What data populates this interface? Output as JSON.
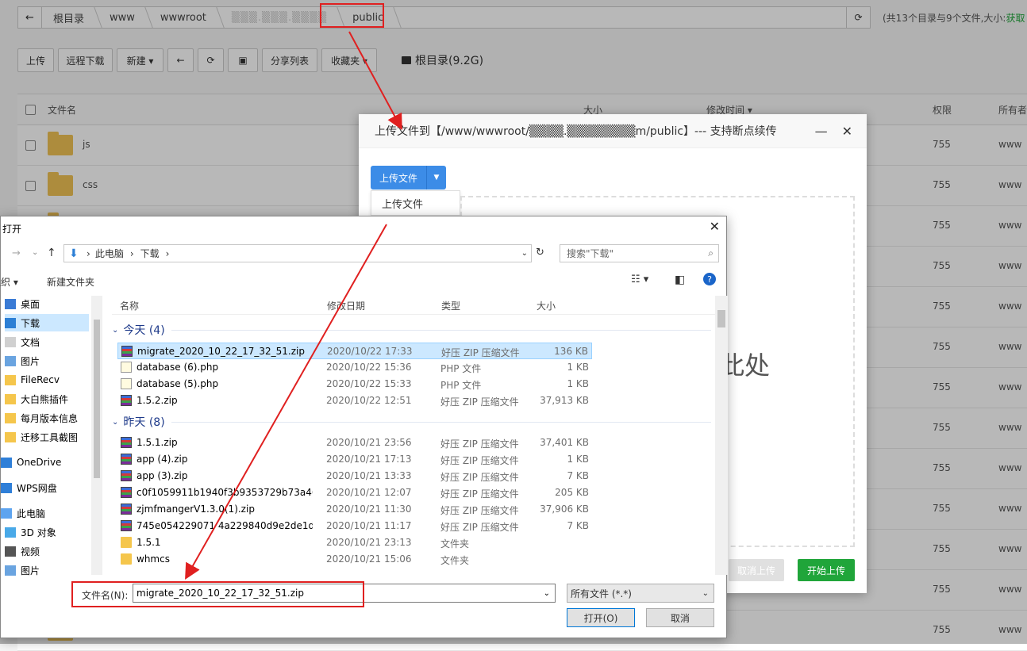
{
  "filemanager": {
    "crumbs": [
      "根目录",
      "www",
      "wwwroot",
      "▒▒▒.▒▒▒.▒▒▒▒",
      "public"
    ],
    "summary": "(共13个目录与9个文件,大小:",
    "summary_link": "获取",
    "toolbar": [
      "上传",
      "远程下载",
      "新建 ▾",
      "←",
      "⟳",
      "▣",
      "分享列表",
      "收藏夹 ▾"
    ],
    "disk": "根目录(9.2G)",
    "headers": {
      "name": "文件名",
      "size": "大小",
      "mtime": "修改时间 ▾",
      "perm": "权限",
      "owner": "所有者"
    },
    "rows": [
      {
        "name": "js",
        "perm": "755",
        "owner": "www"
      },
      {
        "name": "css",
        "perm": "755",
        "owner": "www"
      },
      {
        "name": "",
        "perm": "755",
        "owner": "www"
      },
      {
        "name": "",
        "perm": "755",
        "owner": "www"
      },
      {
        "name": "",
        "perm": "755",
        "owner": "www"
      },
      {
        "name": "",
        "perm": "755",
        "owner": "www"
      },
      {
        "name": "",
        "perm": "755",
        "owner": "www"
      },
      {
        "name": "",
        "perm": "755",
        "owner": "www"
      },
      {
        "name": "",
        "perm": "755",
        "owner": "www"
      },
      {
        "name": "",
        "perm": "755",
        "owner": "www"
      },
      {
        "name": "",
        "perm": "755",
        "owner": "www"
      },
      {
        "name": "",
        "perm": "755",
        "owner": "www"
      },
      {
        "name": "",
        "perm": "755",
        "owner": "www"
      }
    ]
  },
  "upload": {
    "title": "上传文件到【/www/wwwroot/▒▒▒▒.▒▒▒▒▒▒▒▒m/public】--- 支持断点续传",
    "button": "上传文件",
    "dropdown_item": "上传文件",
    "drop_text": "到此处",
    "cancel": "取消上传",
    "start": "开始上传"
  },
  "dialog": {
    "title": "打开",
    "path": [
      "此电脑",
      "下载"
    ],
    "search_placeholder": "搜索\"下载\"",
    "organize": "组织 ▾",
    "new_folder": "新建文件夹",
    "nav": [
      "桌面",
      "下载",
      "文档",
      "图片",
      "FileRecv",
      "大白熊插件",
      "每月版本信息",
      "迁移工具截图",
      "OneDrive",
      "WPS网盘",
      "此电脑",
      "3D 对象",
      "视频",
      "图片"
    ],
    "columns": {
      "name": "名称",
      "date": "修改日期",
      "type": "类型",
      "size": "大小"
    },
    "group_today": "今天 (4)",
    "group_yesterday": "昨天 (8)",
    "today": [
      {
        "name": "migrate_2020_10_22_17_32_51.zip",
        "date": "2020/10/22 17:33",
        "type": "好压 ZIP 压缩文件",
        "size": "136 KB",
        "kind": "zip"
      },
      {
        "name": "database (6).php",
        "date": "2020/10/22 15:36",
        "type": "PHP 文件",
        "size": "1 KB",
        "kind": "php"
      },
      {
        "name": "database (5).php",
        "date": "2020/10/22 15:33",
        "type": "PHP 文件",
        "size": "1 KB",
        "kind": "php"
      },
      {
        "name": "1.5.2.zip",
        "date": "2020/10/22 12:51",
        "type": "好压 ZIP 压缩文件",
        "size": "37,913 KB",
        "kind": "zip"
      }
    ],
    "yesterday": [
      {
        "name": "1.5.1.zip",
        "date": "2020/10/21 23:56",
        "type": "好压 ZIP 压缩文件",
        "size": "37,401 KB",
        "kind": "zip"
      },
      {
        "name": "app (4).zip",
        "date": "2020/10/21 17:13",
        "type": "好压 ZIP 压缩文件",
        "size": "1 KB",
        "kind": "zip"
      },
      {
        "name": "app (3).zip",
        "date": "2020/10/21 13:33",
        "type": "好压 ZIP 压缩文件",
        "size": "7 KB",
        "kind": "zip"
      },
      {
        "name": "c0f1059911b1940f3b9353729b73a46...",
        "date": "2020/10/21 12:07",
        "type": "好压 ZIP 压缩文件",
        "size": "205 KB",
        "kind": "zip"
      },
      {
        "name": "zjmfmangerV1.3.0(1).zip",
        "date": "2020/10/21 11:30",
        "type": "好压 ZIP 压缩文件",
        "size": "37,906 KB",
        "kind": "zip"
      },
      {
        "name": "745e054229071 4a229840d9e2de1d1...",
        "date": "2020/10/21 11:17",
        "type": "好压 ZIP 压缩文件",
        "size": "7 KB",
        "kind": "zip"
      },
      {
        "name": "1.5.1",
        "date": "2020/10/21 23:13",
        "type": "文件夹",
        "size": "",
        "kind": "folder"
      },
      {
        "name": "whmcs",
        "date": "2020/10/21 15:06",
        "type": "文件夹",
        "size": "",
        "kind": "folder"
      }
    ],
    "filename_label": "文件名(N):",
    "filename_value": "migrate_2020_10_22_17_32_51.zip",
    "filetype": "所有文件 (*.*)",
    "open": "打开(O)",
    "cancel": "取消"
  }
}
